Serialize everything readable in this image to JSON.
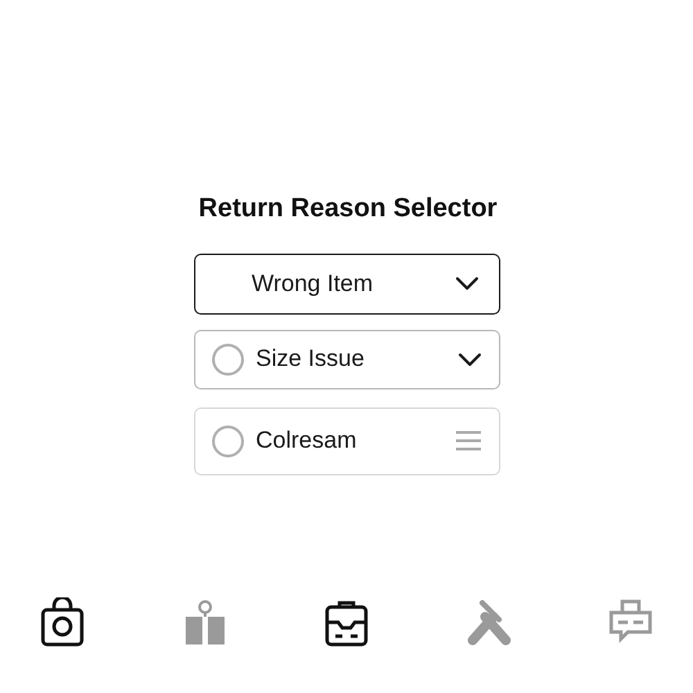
{
  "title": "Return Reason Selector",
  "options": [
    {
      "kind": "dropdown",
      "label": "Wrong Item",
      "selected": true
    },
    {
      "kind": "radio-dropdown",
      "label": "Size Issue",
      "selected": false
    },
    {
      "kind": "radio-handle",
      "label": "Colresam",
      "selected": false
    }
  ],
  "icon_bar": [
    {
      "kind": "bag",
      "active": true
    },
    {
      "kind": "gift",
      "active": false
    },
    {
      "kind": "box",
      "active": true
    },
    {
      "kind": "tools",
      "active": false
    },
    {
      "kind": "chat",
      "active": false
    }
  ]
}
